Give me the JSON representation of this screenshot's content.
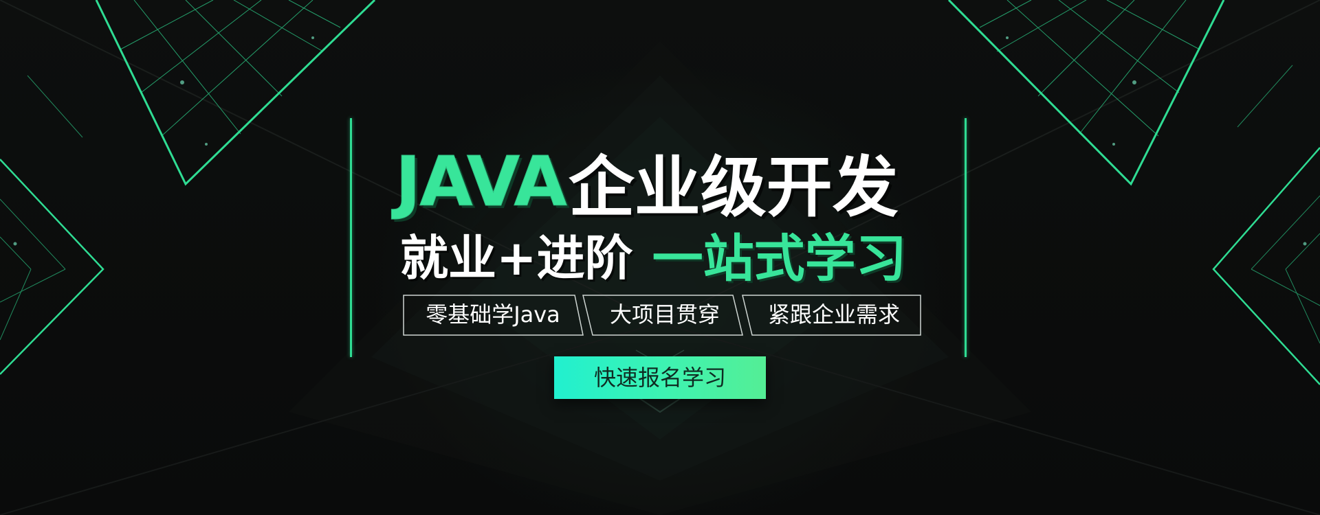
{
  "banner": {
    "title": {
      "accent": "JAVA",
      "main": "企业级开发"
    },
    "subtitle": {
      "main": "就业+进阶",
      "accent": "一站式学习"
    },
    "tags": [
      "零基础学Java",
      "大项目贯穿",
      "紧跟企业需求"
    ],
    "cta_label": "快速报名学习"
  },
  "colors": {
    "accent_green": "#38e59a",
    "line_green": "#2fdc93",
    "cta_gradient_start": "#21f0cf",
    "cta_gradient_end": "#54ee95",
    "background": "#0b0c0c"
  }
}
